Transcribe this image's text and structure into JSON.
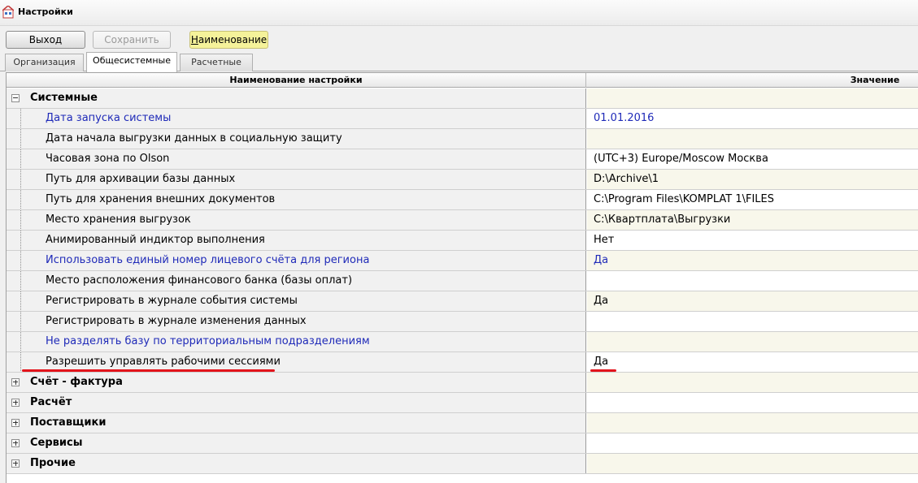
{
  "window": {
    "title": "Настройки"
  },
  "toolbar": {
    "exit_label": "Выход",
    "save_label": "Сохранить",
    "name_label_first": "Н",
    "name_label_rest": "аименование"
  },
  "tabs": [
    "Организация",
    "Общесистемные",
    "Расчетные"
  ],
  "grid": {
    "col_name": "Наименование настройки",
    "col_value": "Значение",
    "groups": [
      {
        "label": "Системные",
        "expanded": true
      },
      {
        "label": "Счёт - фактура",
        "expanded": false
      },
      {
        "label": "Расчёт",
        "expanded": false
      },
      {
        "label": "Поставщики",
        "expanded": false
      },
      {
        "label": "Сервисы",
        "expanded": false
      },
      {
        "label": "Прочие",
        "expanded": false
      }
    ],
    "system_rows": [
      {
        "name": "Дата запуска системы",
        "value": "01.01.2016",
        "modified": true
      },
      {
        "name": "Дата начала выгрузки данных в социальную защиту",
        "value": "",
        "modified": false
      },
      {
        "name": "Часовая зона по Olson",
        "value": "(UTC+3) Europe/Moscow Москва",
        "modified": false
      },
      {
        "name": "Путь для архивации базы данных",
        "value": "D:\\Archive\\1",
        "modified": false
      },
      {
        "name": "Путь для хранения внешних документов",
        "value": "C:\\Program Files\\KOMPLAT 1\\FILES",
        "modified": false
      },
      {
        "name": "Место хранения выгрузок",
        "value": "C:\\Квартплата\\Выгрузки",
        "modified": false
      },
      {
        "name": "Анимированный индиктор выполнения",
        "value": "Нет",
        "modified": false
      },
      {
        "name": "Использовать единый номер лицевого счёта для региона",
        "value": "Да",
        "modified": true
      },
      {
        "name": "Место расположения финансового банка (базы оплат)",
        "value": "",
        "modified": false
      },
      {
        "name": "Регистрировать в журнале события системы",
        "value": "Да",
        "modified": false
      },
      {
        "name": "Регистрировать в журнале изменения данных",
        "value": "",
        "modified": false
      },
      {
        "name": "Не разделять базу по территориальным подразделениям",
        "value": "",
        "modified": true
      },
      {
        "name": "Разрешить управлять рабочими сессиями",
        "value": "Да",
        "modified": false
      }
    ]
  },
  "colors": {
    "modified_text": "#1f2ab8",
    "highlight_underline": "#e3141b",
    "name_button_bg": "#f5f29a"
  }
}
